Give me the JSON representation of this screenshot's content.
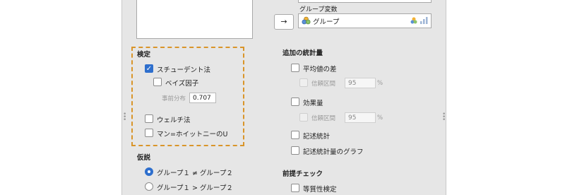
{
  "colors": {
    "accent": "#2e6fcd",
    "highlight_border": "#d9952a",
    "panel_bg": "#e6e6e6"
  },
  "variables": {
    "move_button_label": "→",
    "group_var_label": "グループ変数",
    "group_var_value": "グループ",
    "group_var_icon": "nominal-variable-icon",
    "measure_icon": "measure-type-icon"
  },
  "test": {
    "heading": "検定",
    "student_label": "スチューデント法",
    "bayes_label": "ベイズ因子",
    "prior_label": "事前分布",
    "prior_value": "0.707",
    "welch_label": "ウェルチ法",
    "mann_label": "マン=ホイットニーのU"
  },
  "stats": {
    "heading": "追加の統計量",
    "mean_diff_label": "平均値の差",
    "ci_label_1": "信頼区間",
    "ci_value_1": "95",
    "pct_1": "%",
    "effect_label": "効果量",
    "ci_label_2": "信頼区間",
    "ci_value_2": "95",
    "pct_2": "%",
    "desc_label": "記述統計",
    "desc_plot_label": "記述統計量のグラフ"
  },
  "hypothesis": {
    "heading": "仮説",
    "opt1": "グループ１ ≠ グループ２",
    "opt2": "グループ１ > グループ２"
  },
  "assumptions": {
    "heading": "前提チェック",
    "homogeneity_label": "等質性検定"
  }
}
